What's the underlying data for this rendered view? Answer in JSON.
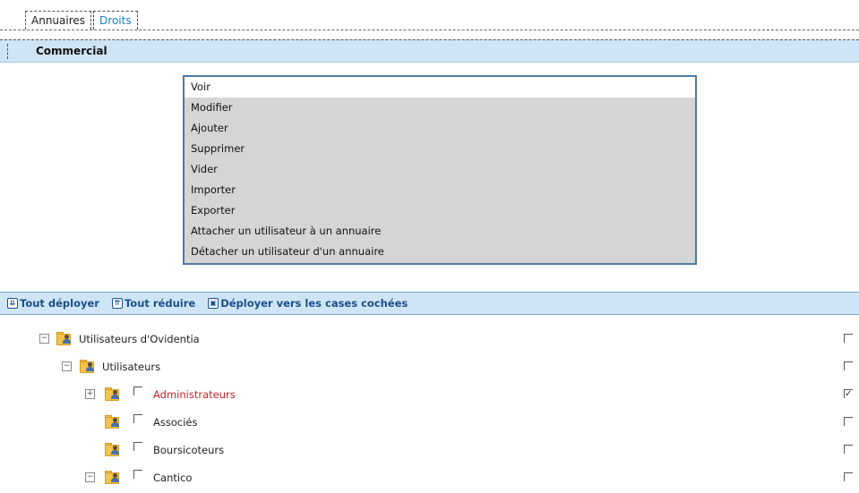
{
  "tabs": [
    {
      "label": "Annuaires",
      "active": false
    },
    {
      "label": "Droits",
      "active": true
    }
  ],
  "section": {
    "title": "Commercial"
  },
  "rights": {
    "options": [
      "Voir",
      "Modifier",
      "Ajouter",
      "Supprimer",
      "Vider",
      "Importer",
      "Exporter",
      "Attacher un utilisateur à un annuaire",
      "Détacher un utilisateur d'un annuaire"
    ],
    "selected": "Voir"
  },
  "actions": {
    "expand_all": "Tout déployer",
    "collapse_all": "Tout réduire",
    "expand_checked": "Déployer vers les cases cochées"
  },
  "tree": [
    {
      "label": "Utilisateurs d'Ovidentia",
      "toggle": "−",
      "level": 0,
      "has_checkbox": false,
      "right_checked": false
    },
    {
      "label": "Utilisateurs",
      "toggle": "−",
      "level": 1,
      "has_checkbox": false,
      "right_checked": false
    },
    {
      "label": "Administrateurs",
      "toggle": "+",
      "level": 2,
      "has_checkbox": true,
      "highlight": true,
      "right_checked": true
    },
    {
      "label": "Associés",
      "toggle": "",
      "level": 2,
      "has_checkbox": true,
      "right_checked": false
    },
    {
      "label": "Boursicoteurs",
      "toggle": "",
      "level": 2,
      "has_checkbox": true,
      "right_checked": false
    },
    {
      "label": "Cantico",
      "toggle": "−",
      "level": 2,
      "has_checkbox": true,
      "right_checked": false
    }
  ],
  "colors": {
    "header_bg": "#cfe5f6",
    "active_tab": "#1d7ec8",
    "highlight_label": "#c0232a"
  }
}
